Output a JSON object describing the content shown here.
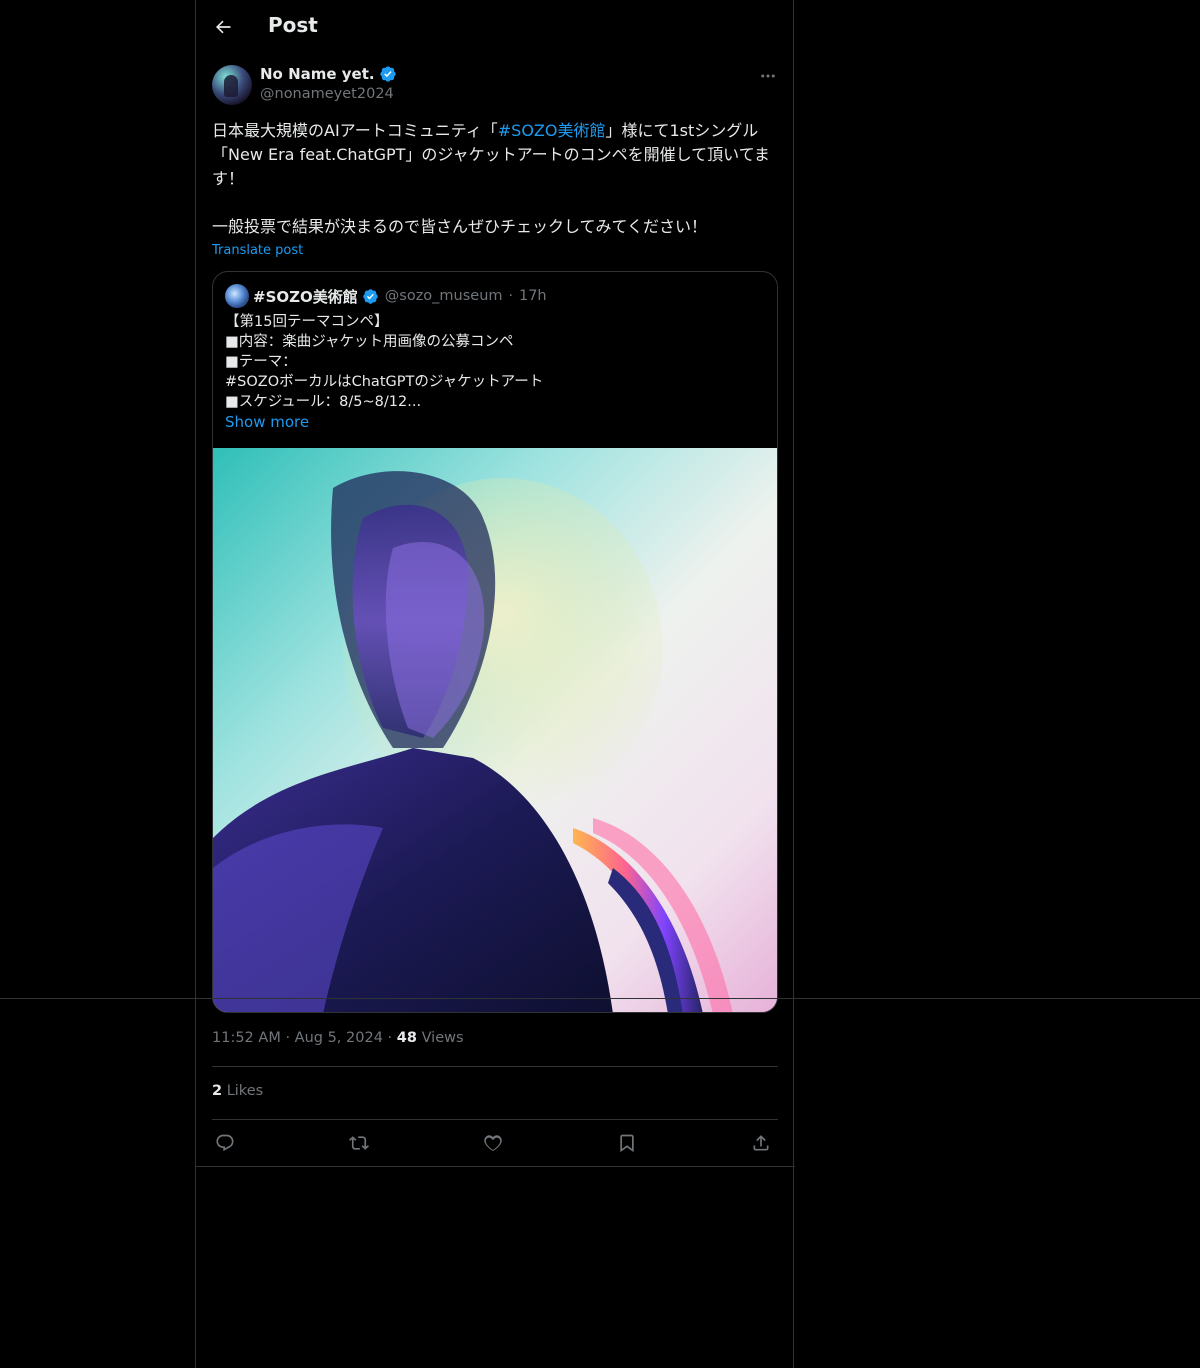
{
  "header": {
    "title": "Post"
  },
  "author": {
    "name": "No Name yet.",
    "handle": "@nonameyet2024",
    "verified": true
  },
  "post": {
    "text_before_link": "日本最大規模のAIアートコミュニティ「",
    "link_text": "#SOZO美術館",
    "text_after_link": "」様にて1stシングル「New Era feat.ChatGPT」のジャケットアートのコンペを開催して頂いてます！\n\n一般投票で結果が決まるので皆さんぜひチェックしてみてください！",
    "translate_label": "Translate post"
  },
  "quote": {
    "name": "#SOZO美術館",
    "handle": "@sozo_museum",
    "dot": "·",
    "time": "17h",
    "text": "【第15回テーマコンペ】\n■内容：楽曲ジャケット用画像の公募コンペ\n■テーマ：\n#SOZOボーカルはChatGPTのジャケットアート\n■スケジュール：8/5~8/12...",
    "show_more": "Show more"
  },
  "meta": {
    "time": "11:52 AM",
    "dot1": "·",
    "date": "Aug 5, 2024",
    "dot2": "·",
    "views_count": "48",
    "views_label": "Views"
  },
  "likes": {
    "count": "2",
    "label": "Likes"
  },
  "colors": {
    "accent": "#1d9bf0",
    "muted": "#71767b",
    "text": "#e7e9ea",
    "border": "#2f3336",
    "background": "#000000"
  },
  "icons": [
    "back-arrow-icon",
    "verified-badge-icon",
    "more-icon",
    "reply-icon",
    "repost-icon",
    "like-icon",
    "bookmark-icon",
    "share-icon"
  ]
}
